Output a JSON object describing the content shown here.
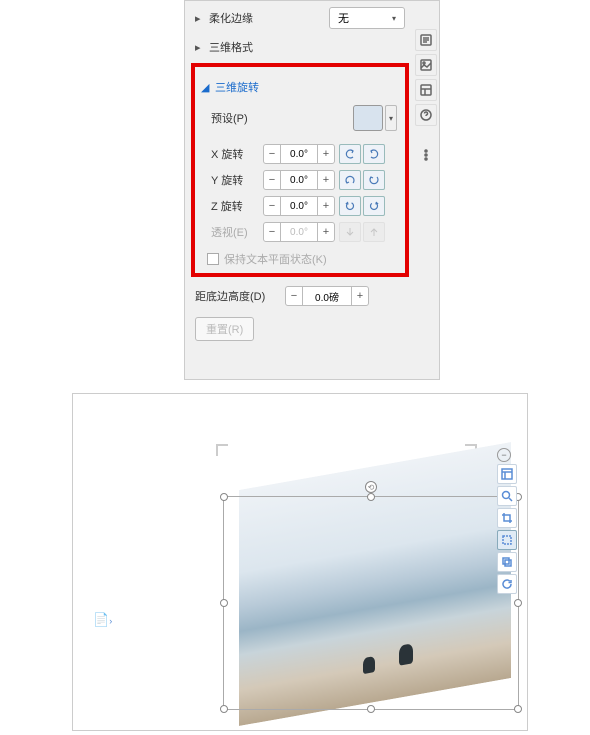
{
  "props": {
    "soft_edge_label": "柔化边缘",
    "soft_edge_value": "无",
    "format_3d_label": "三维格式",
    "rotation_3d_label": "三维旋转",
    "preset_label": "预设(P)",
    "x_rot_label": "X 旋转",
    "y_rot_label": "Y 旋转",
    "z_rot_label": "Z 旋转",
    "perspective_label": "透视(E)",
    "x_rot_value": "0.0°",
    "y_rot_value": "0.0°",
    "z_rot_value": "0.0°",
    "perspective_value": "0.0°",
    "keep_flat_label": "保持文本平面状态(K)",
    "ground_height_label": "距底边高度(D)",
    "ground_height_value": "0.0磅",
    "reset_label": "重置(R)",
    "minus": "−",
    "plus": "+"
  }
}
